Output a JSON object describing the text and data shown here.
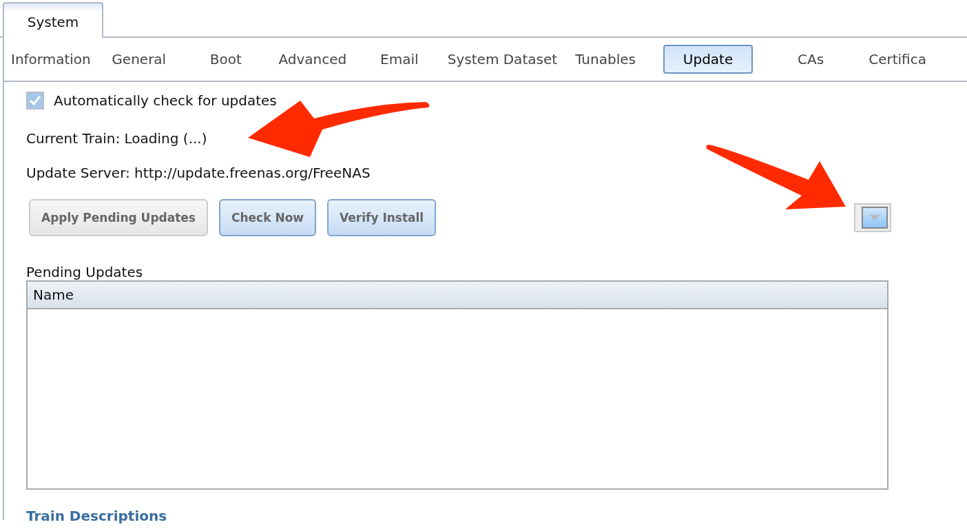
{
  "tabs": [
    {
      "label": "System",
      "selected": true
    }
  ],
  "subtabs": [
    {
      "label": "Information",
      "selected": false
    },
    {
      "label": "General",
      "selected": false
    },
    {
      "label": "Boot",
      "selected": false
    },
    {
      "label": "Advanced",
      "selected": false
    },
    {
      "label": "Email",
      "selected": false
    },
    {
      "label": "System Dataset",
      "selected": false
    },
    {
      "label": "Tunables",
      "selected": false
    },
    {
      "label": "Update",
      "selected": true
    },
    {
      "label": "CAs",
      "selected": false
    },
    {
      "label": "Certifica",
      "selected": false
    }
  ],
  "auto_check": {
    "label": "Automatically check for updates",
    "checked": true
  },
  "current_train": "Current Train: Loading (...)",
  "update_server": "Update Server: http://update.freenas.org/FreeNAS",
  "buttons": [
    {
      "label": "Apply Pending Updates",
      "disabled": true
    },
    {
      "label": "Check Now",
      "disabled": false
    },
    {
      "label": "Verify Install",
      "disabled": false
    }
  ],
  "pending_updates": {
    "title": "Pending Updates",
    "columns": [
      "Name"
    ]
  },
  "section_heading": "Train Descriptions"
}
